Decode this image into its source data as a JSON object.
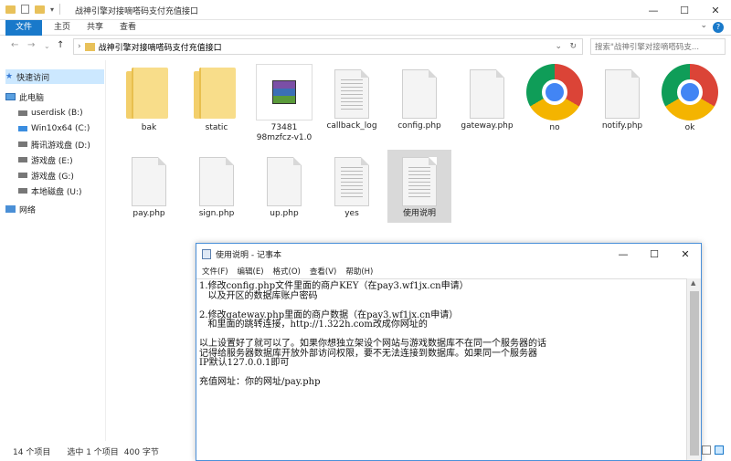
{
  "window": {
    "title": "战神引擎对接嘀嗒码支付充值接口",
    "controls": {
      "minimize": "—",
      "maximize": "☐",
      "close": "✕"
    }
  },
  "ribbon": {
    "tabs": [
      "文件",
      "主页",
      "共享",
      "查看"
    ],
    "help": "?"
  },
  "address": {
    "path": "战神引擎对接嘀嗒码支付充值接口",
    "search_placeholder": "搜索\"战神引擎对接嘀嗒码支..."
  },
  "nav": {
    "quick_access": "快速访问",
    "this_pc": "此电脑",
    "drives": [
      "userdisk (B:)",
      "Win10x64 (C:)",
      "腾讯游戏盘 (D:)",
      "游戏盘 (E:)",
      "游戏盘 (G:)",
      "本地磁盘 (U:)"
    ],
    "network": "网络"
  },
  "files": [
    {
      "name": "bak",
      "icon": "folder-icon"
    },
    {
      "name": "static",
      "icon": "folder-icon"
    },
    {
      "name": "73481\n98mzfcz-v1.0",
      "icon": "rar-archive-icon"
    },
    {
      "name": "callback_log",
      "icon": "text-file-icon"
    },
    {
      "name": "config.php",
      "icon": "file-icon"
    },
    {
      "name": "gateway.php",
      "icon": "file-icon"
    },
    {
      "name": "no",
      "icon": "chrome-icon"
    },
    {
      "name": "notify.php",
      "icon": "file-icon"
    },
    {
      "name": "ok",
      "icon": "chrome-icon"
    },
    {
      "name": "pay.php",
      "icon": "file-icon"
    },
    {
      "name": "sign.php",
      "icon": "file-icon"
    },
    {
      "name": "up.php",
      "icon": "file-icon"
    },
    {
      "name": "yes",
      "icon": "text-file-icon"
    },
    {
      "name": "使用说明",
      "icon": "text-file-icon"
    }
  ],
  "status": {
    "count": "14 个项目",
    "selected": "选中 1 个项目",
    "size": "400 字节"
  },
  "notepad": {
    "title": "使用说明 - 记事本",
    "menu": [
      "文件(F)",
      "编辑(E)",
      "格式(O)",
      "查看(V)",
      "帮助(H)"
    ],
    "text": "1.修改config.php文件里面的商户KEY（在pay3.wf1jx.cn申请）\n   以及开区的数据库账户密码\n\n2.修改gateway.php里面的商户数据（在pay3.wf1jx.cn申请）\n   和里面的跳转连接，http://1.322h.com改成你网址的\n\n以上设置好了就可以了。如果你想独立架设个网站与游戏数据库不在同一个服务器的话\n记得给服务器数据库开放外部访问权限，要不无法连接到数据库。如果同一个服务器\nIP默认127.0.0.1即可\n\n充值网址：你的网址/pay.php"
  }
}
